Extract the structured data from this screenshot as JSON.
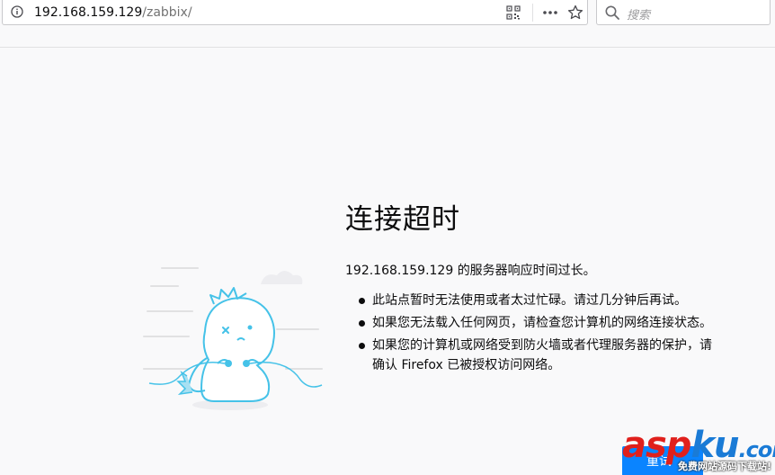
{
  "toolbar": {
    "url_host": "192.168.159.129",
    "url_path": "/zabbix/",
    "search_placeholder": "搜索"
  },
  "error": {
    "title": "连接超时",
    "description": "192.168.159.129 的服务器响应时间过长。",
    "items": [
      "此站点暂时无法使用或者太过忙碌。请过几分钟后再试。",
      "如果您无法载入任何网页，请检查您计算机的网络连接状态。",
      "如果您的计算机或网络受到防火墙或者代理服务器的保护，请确认 Firefox 已被授权访问网络。"
    ],
    "retry_label": "重试"
  },
  "watermark": {
    "text_asp": "asp",
    "text_ku": "ku",
    "text_com": ".com",
    "sub": "免费网站源码下载站!"
  },
  "colors": {
    "accent": "#0a84ff",
    "background": "#f9f9fa",
    "watermark_red": "#e0201c",
    "watermark_blue": "#1a7bd6"
  }
}
